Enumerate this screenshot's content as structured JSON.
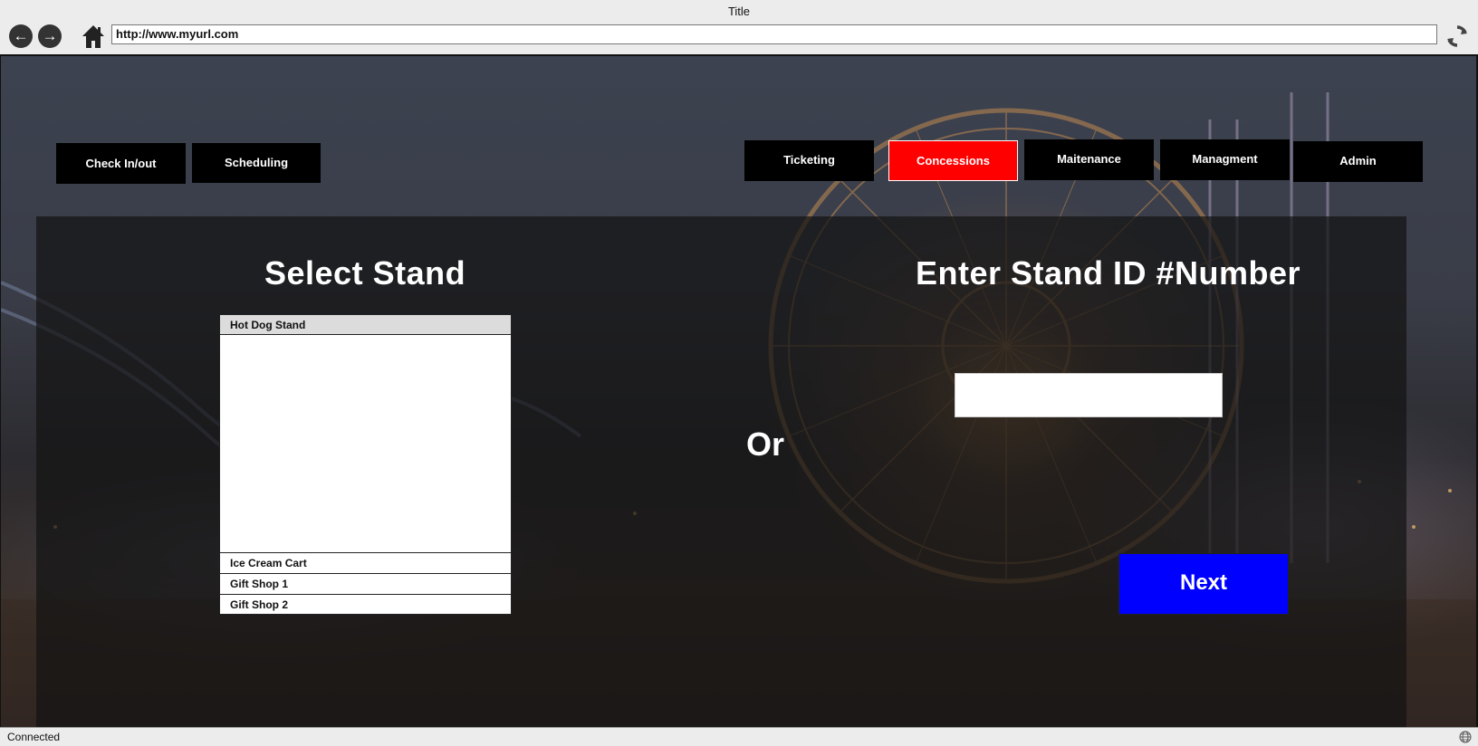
{
  "window": {
    "title": "Title"
  },
  "browser": {
    "url": "http://www.myurl.com",
    "back_icon": "arrow-left-icon",
    "forward_icon": "arrow-right-icon",
    "home_icon": "home-icon",
    "refresh_icon": "refresh-icon"
  },
  "left_nav": [
    {
      "label": "Check In/out"
    },
    {
      "label": "Scheduling"
    }
  ],
  "right_nav": [
    {
      "label": "Ticketing",
      "active": false
    },
    {
      "label": "Concessions",
      "active": true
    },
    {
      "label": "Maitenance",
      "active": false
    },
    {
      "label": "Managment",
      "active": false
    },
    {
      "label": "Admin",
      "active": false
    }
  ],
  "main": {
    "select_heading": "Select Stand",
    "stands": [
      "Hot Dog Stand",
      "Ice Cream Cart",
      "Gift Shop 1",
      "Gift Shop 2"
    ],
    "selected_stand": "Hot Dog Stand",
    "or_label": "Or",
    "enter_heading": "Enter Stand ID #Number",
    "stand_id_value": "",
    "next_label": "Next"
  },
  "colors": {
    "active_tab": "#ff0000",
    "next_button": "#0000ff",
    "nav_button": "#000000"
  },
  "status": {
    "text": "Connected",
    "icon": "globe-icon"
  }
}
